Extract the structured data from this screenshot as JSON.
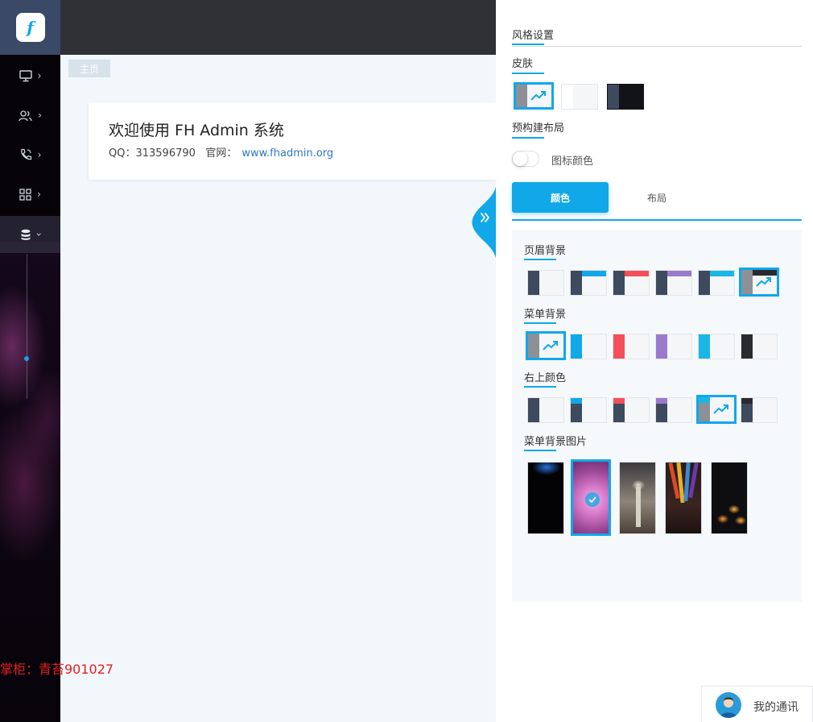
{
  "sidebar": {
    "items": [
      {
        "icon": "monitor-icon"
      },
      {
        "icon": "users-icon"
      },
      {
        "icon": "phone-icon"
      },
      {
        "icon": "grid-icon"
      },
      {
        "icon": "database-icon",
        "expanded": true
      }
    ]
  },
  "tabs": {
    "home": "主页"
  },
  "welcome": {
    "title": "欢迎使用 FH Admin 系统",
    "qq_label": "QQ：313596790",
    "site_label": "官网：",
    "site_url": "www.fhadmin.org"
  },
  "watermark": "掌柜：青苔901027",
  "panel": {
    "title": "风格设置",
    "skin_label": "皮肤",
    "prebuilt_label": "预构建布局",
    "icon_color_label": "图标颜色",
    "tab_color": "颜色",
    "tab_layout": "布局",
    "header_bg_label": "页眉背景",
    "menu_bg_label": "菜单背景",
    "top_right_label": "右上颜色",
    "menu_img_label": "菜单背景图片"
  },
  "colors": {
    "accent": "#10a8e8",
    "dark_navy": "#3e4a5e",
    "blue": "#10a8e8",
    "red": "#f4505a",
    "purple": "#9a7acd",
    "cyan": "#1ab7e6",
    "black": "#2a2b2e"
  },
  "contact": {
    "label": "我的通讯"
  }
}
